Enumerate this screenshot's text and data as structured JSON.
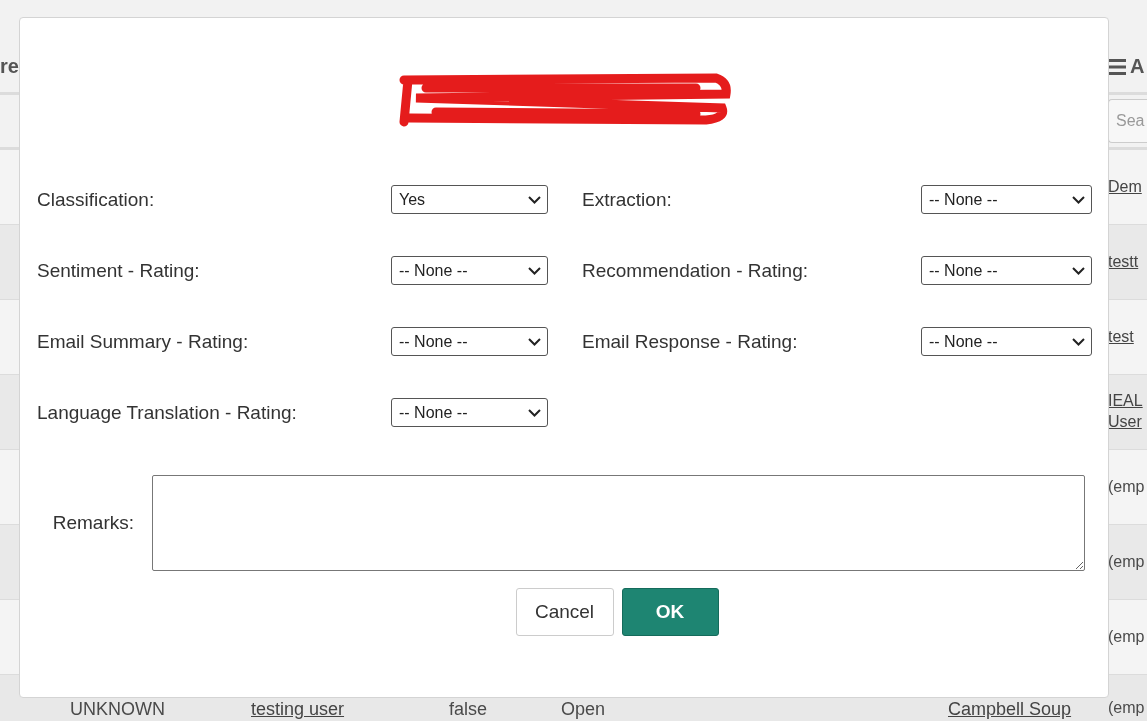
{
  "background_table": {
    "header": {
      "column_1": "re",
      "column_8": "A"
    },
    "search": {
      "placeholder": "Sea"
    },
    "rows": [
      {
        "column_8": {
          "text": "Dem",
          "kind": "link"
        }
      },
      {
        "column_8": {
          "text": "testt",
          "kind": "link"
        }
      },
      {
        "column_8": {
          "text": "test",
          "kind": "link"
        }
      },
      {
        "column_8": {
          "text": "IEAL User",
          "kind": "link"
        }
      },
      {
        "column_8": {
          "text": "(emp",
          "kind": "plain"
        }
      },
      {
        "column_8": {
          "text": "(emp",
          "kind": "plain"
        }
      },
      {
        "column_8": {
          "text": "(emp",
          "kind": "plain"
        }
      },
      {
        "column_2": {
          "text": "UNKNOWN",
          "kind": "plain"
        },
        "column_3": {
          "text": "testing user",
          "kind": "link"
        },
        "column_4": {
          "text": "false",
          "kind": "plain"
        },
        "column_5": {
          "text": "Open",
          "kind": "plain"
        },
        "column_7": {
          "text": "Campbell Soup",
          "kind": "link"
        },
        "column_8": {
          "text": "(emp",
          "kind": "plain"
        }
      }
    ]
  },
  "dialog": {
    "title_redacted": true,
    "fields": [
      {
        "label": "Classification:",
        "value": "Yes"
      },
      {
        "label": "Extraction:",
        "value": "-- None --"
      },
      {
        "label": "Sentiment - Rating:",
        "value": "-- None --"
      },
      {
        "label": "Recommendation - Rating:",
        "value": "-- None --"
      },
      {
        "label": "Email Summary - Rating:",
        "value": "-- None --"
      },
      {
        "label": "Email Response - Rating:",
        "value": "-- None --"
      },
      {
        "label": "Language Translation - Rating:",
        "value": "-- None --"
      }
    ],
    "remarks": {
      "label": "Remarks:"
    },
    "buttons": [
      {
        "label": "Cancel",
        "kind": "secondary"
      },
      {
        "label": "OK",
        "kind": "primary"
      }
    ]
  }
}
